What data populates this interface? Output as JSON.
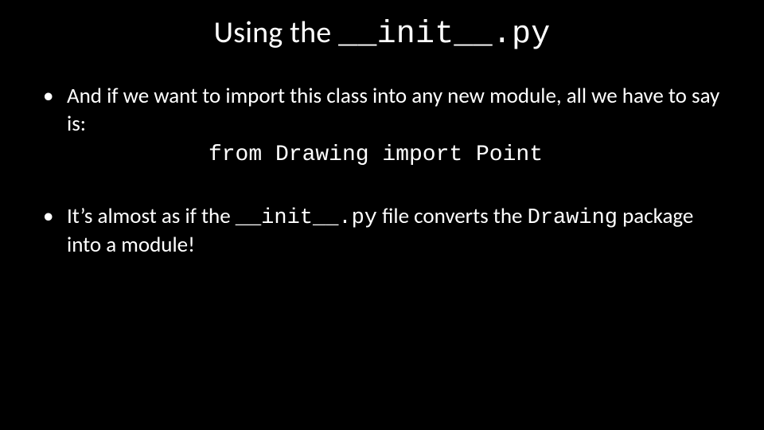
{
  "title": {
    "prefix": "Using the ",
    "code": "__init__.py"
  },
  "bullets": [
    {
      "text": "And if we want to import this class into any new module, all we have to say is:",
      "code_line": "from Drawing import Point"
    },
    {
      "parts": {
        "a": "It’s almost as if the ",
        "code1": "__init__.py",
        "b": " file converts the ",
        "code2": "Drawing",
        "c": " package into a module!"
      }
    }
  ]
}
